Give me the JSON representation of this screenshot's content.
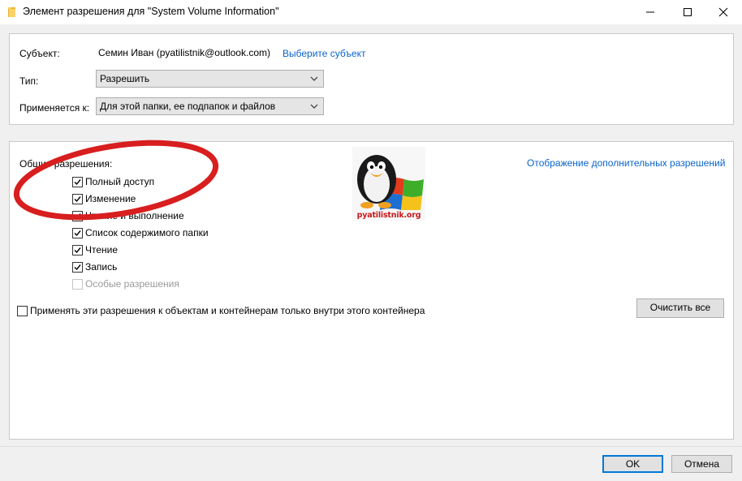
{
  "window": {
    "title": "Элемент разрешения для \"System Volume Information\"",
    "icons": {
      "folder": "folder-icon",
      "minimize": "minimize-icon",
      "maximize": "maximize-icon",
      "close": "close-icon"
    }
  },
  "principal": {
    "label": "Субъект:",
    "value": "Семин Иван (pyatilistnik@outlook.com)",
    "select_link": "Выберите субъект"
  },
  "type": {
    "label": "Тип:",
    "value": "Разрешить"
  },
  "applies_to": {
    "label": "Применяется к:",
    "value": "Для этой папки, ее подпапок и файлов"
  },
  "permissions": {
    "heading": "Общие разрешения:",
    "advanced_link": "Отображение дополнительных разрешений",
    "items": [
      {
        "label": "Полный доступ",
        "checked": true,
        "enabled": true
      },
      {
        "label": "Изменение",
        "checked": true,
        "enabled": true
      },
      {
        "label": "Чтение и выполнение",
        "checked": true,
        "enabled": true
      },
      {
        "label": "Список содержимого папки",
        "checked": true,
        "enabled": true
      },
      {
        "label": "Чтение",
        "checked": true,
        "enabled": true
      },
      {
        "label": "Запись",
        "checked": true,
        "enabled": true
      },
      {
        "label": "Особые разрешения",
        "checked": false,
        "enabled": false
      }
    ]
  },
  "container_only": {
    "label": "Применять эти разрешения к объектам и контейнерам только внутри этого контейнера",
    "checked": false
  },
  "clear_all_label": "Очистить все",
  "watermark": {
    "text": "pyatilistnik.org",
    "icon": "penguin-windows-logo"
  },
  "annotation_color": "#d81e1e",
  "buttons": {
    "ok": "OK",
    "cancel": "Отмена"
  }
}
